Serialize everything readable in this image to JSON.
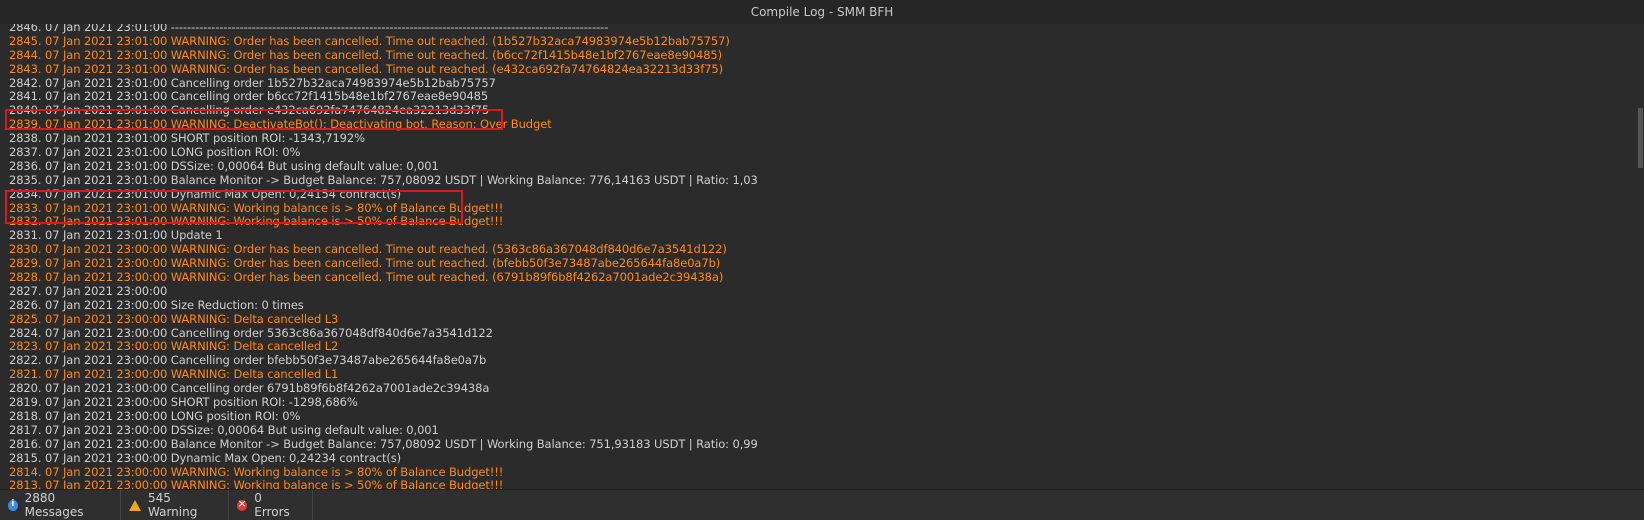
{
  "window": {
    "title": "Compile Log - SMM BFH"
  },
  "log": [
    {
      "text": "2846. 07 Jan 2021 23:01:00 ------------------------------------------------------------------------------------------------------------",
      "level": "info"
    },
    {
      "text": "2845. 07 Jan 2021 23:01:00 WARNING: Order has been cancelled. Time out reached. (1b527b32aca74983974e5b12bab75757)",
      "level": "warn"
    },
    {
      "text": "2844. 07 Jan 2021 23:01:00 WARNING: Order has been cancelled. Time out reached. (b6cc72f1415b48e1bf2767eae8e90485)",
      "level": "warn"
    },
    {
      "text": "2843. 07 Jan 2021 23:01:00 WARNING: Order has been cancelled. Time out reached. (e432ca692fa74764824ea32213d33f75)",
      "level": "warn"
    },
    {
      "text": "2842. 07 Jan 2021 23:01:00 Cancelling order 1b527b32aca74983974e5b12bab75757",
      "level": "info"
    },
    {
      "text": "2841. 07 Jan 2021 23:01:00 Cancelling order b6cc72f1415b48e1bf2767eae8e90485",
      "level": "info"
    },
    {
      "text": "2840. 07 Jan 2021 23:01:00 Cancelling order e432ca692fa74764824ea32213d33f75",
      "level": "info"
    },
    {
      "text": "2839. 07 Jan 2021 23:01:00 WARNING: DeactivateBot(): Deactivating bot. Reason: Over Budget",
      "level": "warn"
    },
    {
      "text": "2838. 07 Jan 2021 23:01:00 SHORT position ROI: -1343,7192%",
      "level": "info"
    },
    {
      "text": "2837. 07 Jan 2021 23:01:00 LONG position ROI: 0%",
      "level": "info"
    },
    {
      "text": "2836. 07 Jan 2021 23:01:00 DSSize: 0,00064 But using default value: 0,001",
      "level": "info"
    },
    {
      "text": "2835. 07 Jan 2021 23:01:00 Balance Monitor -> Budget Balance: 757,08092 USDT | Working Balance: 776,14163 USDT | Ratio: 1,03",
      "level": "info"
    },
    {
      "text": "2834. 07 Jan 2021 23:01:00 Dynamic Max Open: 0,24154 contract(s)",
      "level": "info"
    },
    {
      "text": "2833. 07 Jan 2021 23:01:00 WARNING: Working balance is > 80% of Balance Budget!!!",
      "level": "warn"
    },
    {
      "text": "2832. 07 Jan 2021 23:01:00 WARNING: Working balance is > 50% of Balance Budget!!!",
      "level": "warn"
    },
    {
      "text": "2831. 07 Jan 2021 23:01:00 Update 1",
      "level": "info"
    },
    {
      "text": "2830. 07 Jan 2021 23:00:00 WARNING: Order has been cancelled. Time out reached. (5363c86a367048df840d6e7a3541d122)",
      "level": "warn"
    },
    {
      "text": "2829. 07 Jan 2021 23:00:00 WARNING: Order has been cancelled. Time out reached. (bfebb50f3e73487abe265644fa8e0a7b)",
      "level": "warn"
    },
    {
      "text": "2828. 07 Jan 2021 23:00:00 WARNING: Order has been cancelled. Time out reached. (6791b89f6b8f4262a7001ade2c39438a)",
      "level": "warn"
    },
    {
      "text": "2827. 07 Jan 2021 23:00:00",
      "level": "info"
    },
    {
      "text": "2826. 07 Jan 2021 23:00:00 Size Reduction: 0 times",
      "level": "info"
    },
    {
      "text": "2825. 07 Jan 2021 23:00:00 WARNING: Delta cancelled L3",
      "level": "warn"
    },
    {
      "text": "2824. 07 Jan 2021 23:00:00 Cancelling order 5363c86a367048df840d6e7a3541d122",
      "level": "info"
    },
    {
      "text": "2823. 07 Jan 2021 23:00:00 WARNING: Delta cancelled L2",
      "level": "warn"
    },
    {
      "text": "2822. 07 Jan 2021 23:00:00 Cancelling order bfebb50f3e73487abe265644fa8e0a7b",
      "level": "info"
    },
    {
      "text": "2821. 07 Jan 2021 23:00:00 WARNING: Delta cancelled L1",
      "level": "warn"
    },
    {
      "text": "2820. 07 Jan 2021 23:00:00 Cancelling order 6791b89f6b8f4262a7001ade2c39438a",
      "level": "info"
    },
    {
      "text": "2819. 07 Jan 2021 23:00:00 SHORT position ROI: -1298,686%",
      "level": "info"
    },
    {
      "text": "2818. 07 Jan 2021 23:00:00 LONG position ROI: 0%",
      "level": "info"
    },
    {
      "text": "2817. 07 Jan 2021 23:00:00 DSSize: 0,00064 But using default value: 0,001",
      "level": "info"
    },
    {
      "text": "2816. 07 Jan 2021 23:00:00 Balance Monitor -> Budget Balance: 757,08092 USDT | Working Balance: 751,93183 USDT | Ratio: 0,99",
      "level": "info"
    },
    {
      "text": "2815. 07 Jan 2021 23:00:00 Dynamic Max Open: 0,24234 contract(s)",
      "level": "info"
    },
    {
      "text": "2814. 07 Jan 2021 23:00:00 WARNING: Working balance is > 80% of Balance Budget!!!",
      "level": "warn"
    },
    {
      "text": "2813. 07 Jan 2021 23:00:00 WARNING: Working balance is > 50% of Balance Budget!!!",
      "level": "warn"
    }
  ],
  "status": {
    "messages": "2880 Messages",
    "warnings": "545 Warning",
    "errors": "0 Errors"
  },
  "colors": {
    "warning_text": "#ff8a1e",
    "info_text": "#cfcfcf",
    "highlight_box": "#e0161f",
    "background": "#2b2b2b"
  }
}
